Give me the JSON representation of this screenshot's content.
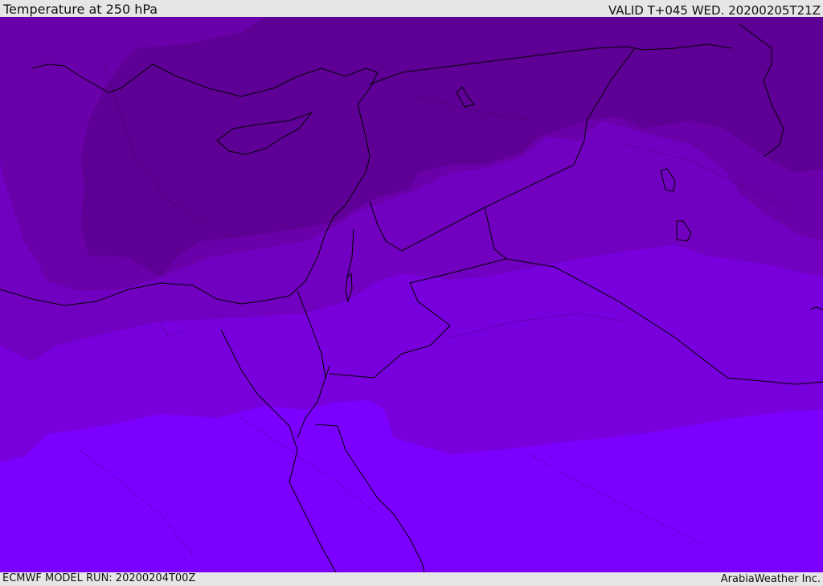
{
  "header": {
    "title": "Temperature at 250 hPa",
    "valid_time": "VALID T+045 WED. 20200205T21Z"
  },
  "footer": {
    "model_run": "ECMWF MODEL RUN: 20200204T00Z",
    "credit": "ArabiaWeather Inc."
  },
  "map": {
    "layers": [
      "temperature-shading",
      "coastlines",
      "country-borders",
      "contours"
    ],
    "colors": {
      "coldest": "#5e0096",
      "cold": "#6a00aa",
      "mid": "#7100c0",
      "warm": "#7700dc",
      "warmest": "#7c00ff"
    }
  }
}
